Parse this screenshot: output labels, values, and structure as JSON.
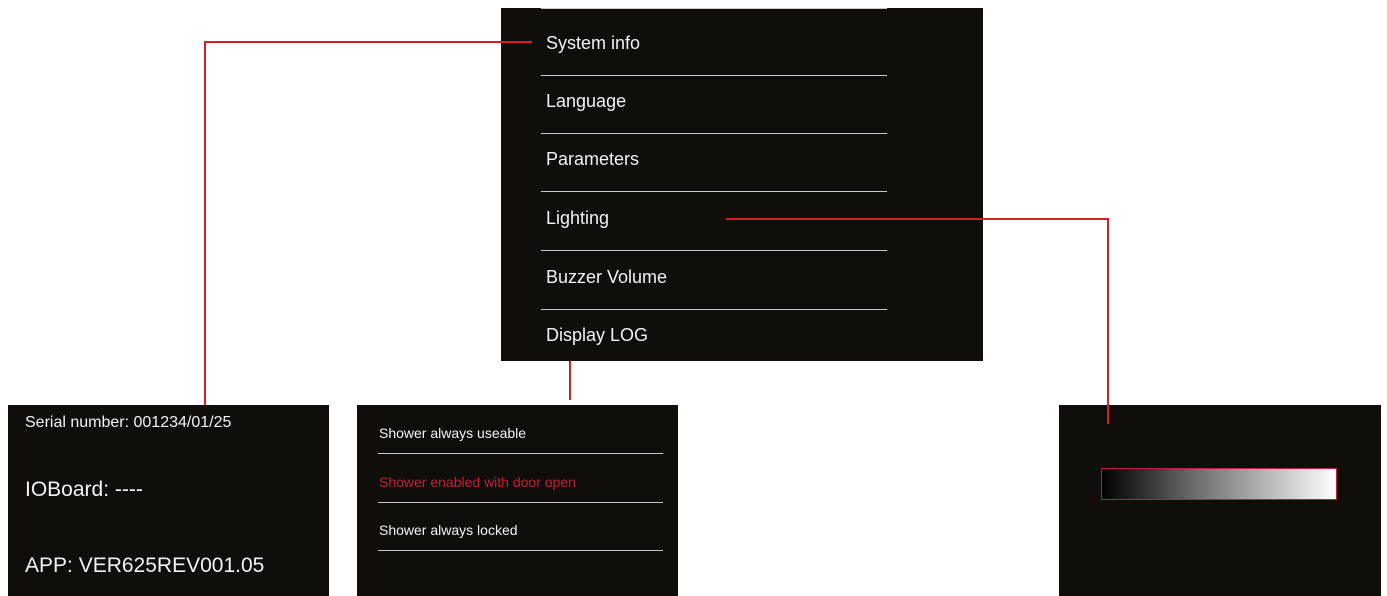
{
  "main_menu": {
    "items": [
      {
        "label": "System info"
      },
      {
        "label": "Language"
      },
      {
        "label": "Parameters"
      },
      {
        "label": "Lighting"
      },
      {
        "label": "Buzzer Volume"
      },
      {
        "label": "Display LOG"
      }
    ]
  },
  "system_info": {
    "serial": "Serial number: 001234/01/25",
    "ioboard": "IOBoard: ----",
    "app": "APP: VER625REV001.05"
  },
  "parameters": {
    "items": [
      {
        "label": "Shower always useable"
      },
      {
        "label": "Shower enabled with door open",
        "selected": true
      },
      {
        "label": "Shower always locked"
      }
    ]
  },
  "lighting": {
    "brightness_bar": "black-to-white gradient"
  },
  "colors": {
    "panel_background": "#0f0e0a",
    "connector": "#d81f1f",
    "highlight": "#c01e3c",
    "divider": "#c8c8c8",
    "text": "#f2f2f2"
  }
}
